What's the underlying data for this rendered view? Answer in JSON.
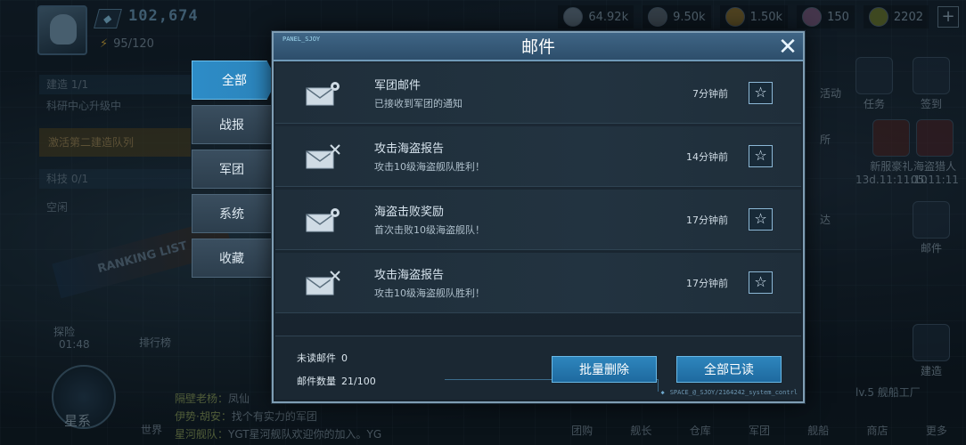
{
  "background": {
    "power": "102,674",
    "energy": "95/120",
    "resources": [
      {
        "icon": "ore-icon",
        "value": "64.92k"
      },
      {
        "icon": "alloy-icon",
        "value": "9.50k"
      },
      {
        "icon": "fuel-icon",
        "value": "1.50k"
      },
      {
        "icon": "crystal-icon",
        "value": "150"
      },
      {
        "icon": "credit-icon",
        "value": "2202"
      }
    ],
    "left_panel": {
      "build": "建造 1/1",
      "center": "科研中心升级中",
      "activate": "激活第二建造队列",
      "tech": "科技 0/1",
      "empty": "空闲"
    },
    "ranking_banner": "RANKING LIST",
    "explore": "探险",
    "explore_time": "01:48",
    "ranking_label": "排行榜",
    "galaxy": "星系",
    "world": "世界",
    "chat": [
      {
        "name": "隔壁老杨：",
        "text": "凤仙"
      },
      {
        "name": "伊势·胡安：",
        "text": "找个有实力的军团"
      },
      {
        "name": "星河舰队：",
        "text": "YGT星河舰队欢迎你的加入。YG"
      }
    ],
    "right_icons": [
      {
        "label": "活动"
      },
      {
        "label": "任务"
      },
      {
        "label": "签到"
      },
      {
        "label": "所"
      },
      {
        "label": "新服豪礼",
        "sub": "13d.11:11:10"
      },
      {
        "label": "海盗猎人",
        "sub": "05:11:11"
      },
      {
        "label": "达"
      },
      {
        "label": "邮件"
      },
      {
        "label": "建造"
      }
    ],
    "bottom_bar": [
      "团购",
      "舰长",
      "仓库",
      "军团",
      "舰船",
      "商店",
      "更多"
    ],
    "factory_label": "lv.5 舰船工厂"
  },
  "dialog": {
    "tag": "PANEL_SJOY",
    "title": "邮件",
    "close": "✕",
    "tabs": [
      {
        "label": "全部",
        "active": true
      },
      {
        "label": "战报",
        "active": false
      },
      {
        "label": "军团",
        "active": false
      },
      {
        "label": "系统",
        "active": false
      },
      {
        "label": "收藏",
        "active": false
      }
    ],
    "mails": [
      {
        "icon": "mail-gear-icon",
        "title": "军团邮件",
        "subtitle": "已接收到军团的通知",
        "time": "7分钟前"
      },
      {
        "icon": "mail-battle-icon",
        "title": "攻击海盗报告",
        "subtitle": "攻击10级海盗舰队胜利！",
        "time": "14分钟前"
      },
      {
        "icon": "mail-gear-icon",
        "title": "海盗击败奖励",
        "subtitle": "首次击败10级海盗舰队！",
        "time": "17分钟前"
      },
      {
        "icon": "mail-battle-icon",
        "title": "攻击海盗报告",
        "subtitle": "攻击10级海盗舰队胜利！",
        "time": "17分钟前"
      }
    ],
    "star_glyph": "☆",
    "footer": {
      "unread_label": "未读邮件",
      "unread_value": "0",
      "count_label": "邮件数量",
      "count_value": "21/100",
      "delete_button": "批量删除",
      "read_all_button": "全部已读",
      "tag": "SPACE_@_SJOY/2164242_system_contrl"
    }
  },
  "colors": {
    "accent": "#2d8cc7",
    "dialog_border": "#7f9eb4",
    "header": "#2d4e6b"
  }
}
